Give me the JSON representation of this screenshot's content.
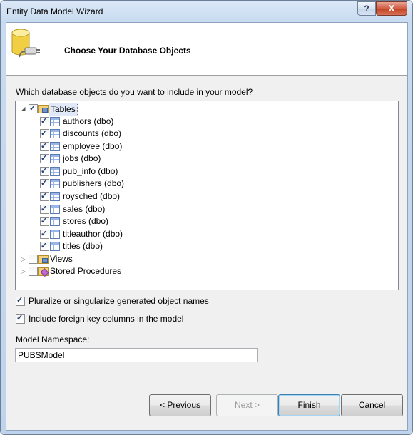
{
  "window": {
    "title": "Entity Data Model Wizard",
    "help_label": "?",
    "close_label": "X"
  },
  "header": {
    "title": "Choose Your Database Objects"
  },
  "question": "Which database objects do you want to include in your model?",
  "tree": {
    "tables_label": "Tables",
    "tables": [
      "authors (dbo)",
      "discounts (dbo)",
      "employee (dbo)",
      "jobs (dbo)",
      "pub_info (dbo)",
      "publishers (dbo)",
      "roysched (dbo)",
      "sales (dbo)",
      "stores (dbo)",
      "titleauthor (dbo)",
      "titles (dbo)"
    ],
    "views_label": "Views",
    "procedures_label": "Stored Procedures"
  },
  "options": {
    "pluralize": "Pluralize or singularize generated object names",
    "foreign_keys": "Include foreign key columns in the model"
  },
  "namespace": {
    "label": "Model Namespace:",
    "value": "PUBSModel"
  },
  "buttons": {
    "previous": "< Previous",
    "next": "Next >",
    "finish": "Finish",
    "cancel": "Cancel"
  }
}
